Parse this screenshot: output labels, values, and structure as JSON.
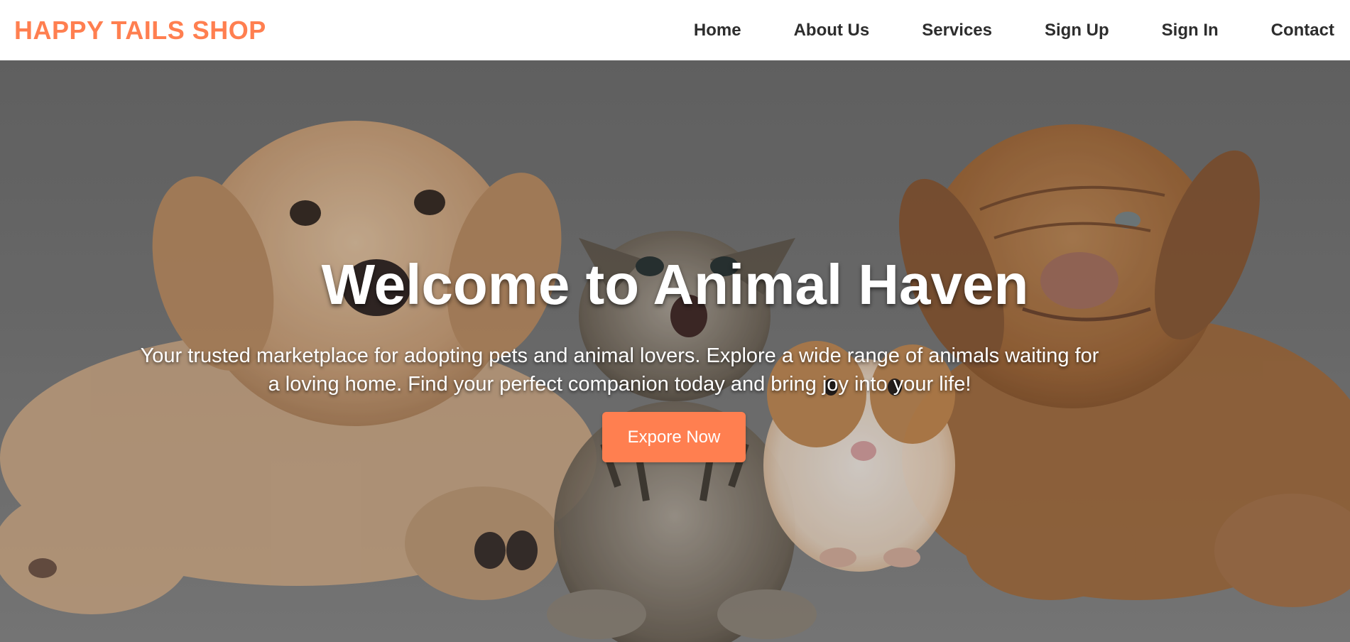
{
  "header": {
    "logo": "HAPPY TAILS SHOP",
    "nav": [
      {
        "label": "Home"
      },
      {
        "label": "About Us"
      },
      {
        "label": "Services"
      },
      {
        "label": "Sign Up"
      },
      {
        "label": "Sign In"
      },
      {
        "label": "Contact"
      }
    ]
  },
  "hero": {
    "title": "Welcome to Animal Haven",
    "description": "Your trusted marketplace for adopting pets and animal lovers. Explore a wide range of animals waiting for a loving home. Find your perfect companion today and bring joy into your life!",
    "cta_label": "Expore Now",
    "image_subjects": [
      "puppy",
      "kitten",
      "guinea-pig",
      "shar-pei-puppy"
    ]
  },
  "colors": {
    "accent": "#ff7f50",
    "nav_text": "#2d2d2d",
    "hero_text": "#ffffff"
  }
}
